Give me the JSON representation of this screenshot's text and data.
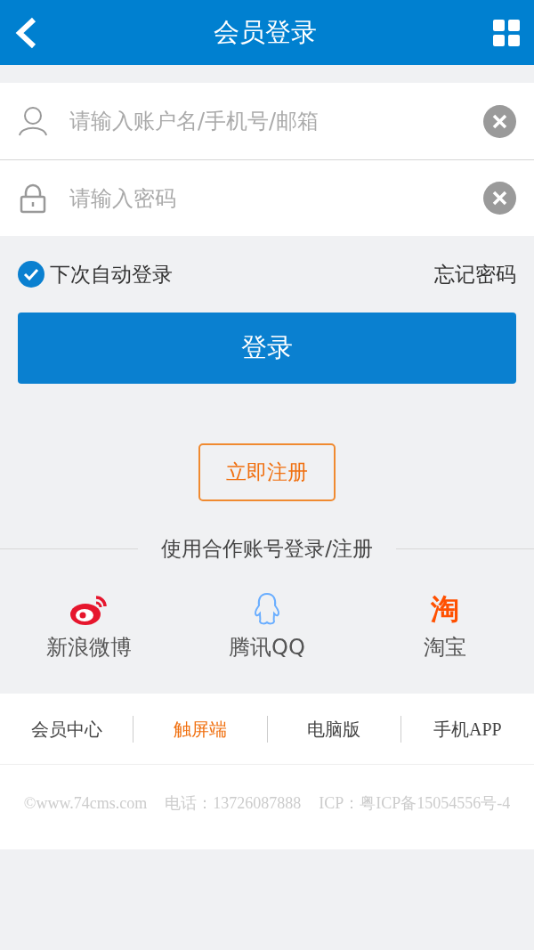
{
  "header": {
    "title": "会员登录"
  },
  "fields": [
    {
      "kind": "account",
      "placeholder": "请输入账户名/手机号/邮箱"
    },
    {
      "kind": "password",
      "placeholder": "请输入密码"
    }
  ],
  "remember": {
    "label": "下次自动登录",
    "checked": true
  },
  "forgot": "忘记密码",
  "login_button": "登录",
  "register_button": "立即注册",
  "partner_heading": "使用合作账号登录/注册",
  "partners": [
    {
      "kind": "weibo",
      "label": "新浪微博"
    },
    {
      "kind": "qq",
      "label": "腾讯QQ"
    },
    {
      "kind": "taobao",
      "label": "淘宝",
      "glyph": "淘"
    }
  ],
  "footer_nav": [
    {
      "label": "会员中心",
      "selected": false
    },
    {
      "label": "触屏端",
      "selected": true
    },
    {
      "label": "电脑版",
      "selected": false
    },
    {
      "label": "手机APP",
      "selected": false
    }
  ],
  "copyright": [
    "©www.74cms.com",
    "电话：13726087888",
    "ICP：粤ICP备15054556号-4"
  ]
}
